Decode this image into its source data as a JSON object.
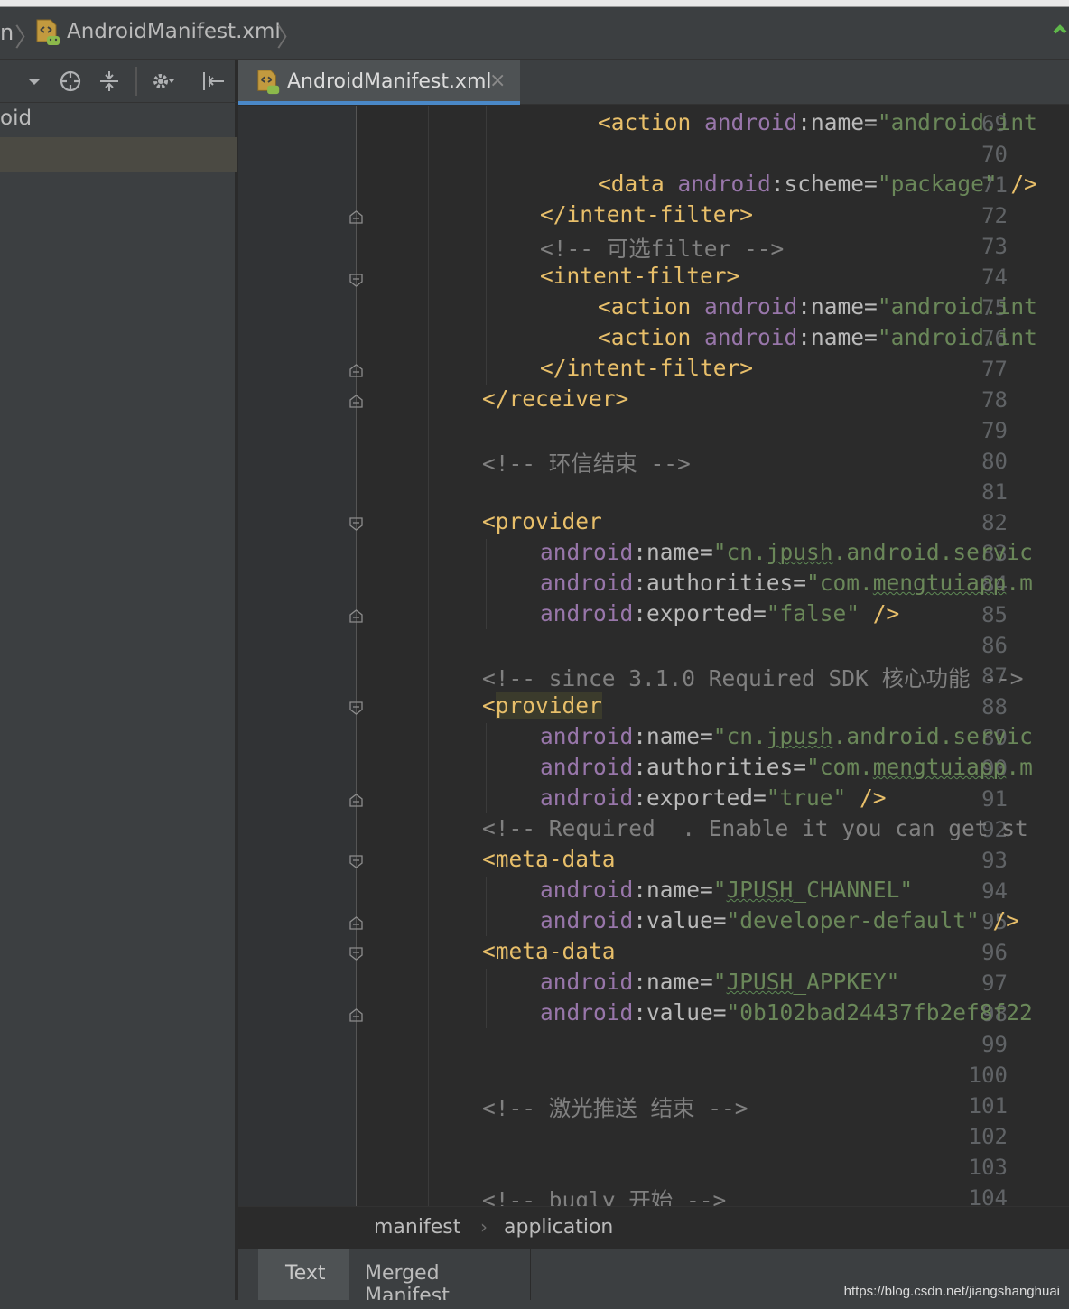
{
  "nav": {
    "crumb_start": "n",
    "file": "AndroidManifest.xml"
  },
  "project": {
    "tree_row": "oid"
  },
  "tab": {
    "label": "AndroidManifest.xml",
    "close": "×"
  },
  "line_numbers": [
    "69",
    "70",
    "71",
    "72",
    "73",
    "74",
    "75",
    "76",
    "77",
    "78",
    "79",
    "80",
    "81",
    "82",
    "83",
    "84",
    "85",
    "86",
    "87",
    "88",
    "89",
    "90",
    "91",
    "92",
    "93",
    "94",
    "95",
    "96",
    "97",
    "98",
    "99",
    "100",
    "101",
    "102",
    "103",
    "104"
  ],
  "code": {
    "l69": {
      "tag": "<action",
      "ns": "android",
      "attr": ":name=",
      "val": "\"android.int"
    },
    "l71": {
      "tag": "<data",
      "ns": "android",
      "attr": ":scheme=",
      "val": "\"package\"",
      "close": " />"
    },
    "l72": {
      "tag": "</intent-filter>"
    },
    "l73": {
      "cmt": "<!-- 可选filter -->"
    },
    "l74": {
      "tag": "<intent-filter>"
    },
    "l75": {
      "tag": "<action",
      "ns": "android",
      "attr": ":name=",
      "val": "\"android.int"
    },
    "l76": {
      "tag": "<action",
      "ns": "android",
      "attr": ":name=",
      "val": "\"android.int"
    },
    "l77": {
      "tag": "</intent-filter>"
    },
    "l78": {
      "tag": "</receiver>"
    },
    "l80": {
      "cmt": "<!-- 环信结束 -->"
    },
    "l82": {
      "tag": "<provider"
    },
    "l83": {
      "ns": "android",
      "attr": ":name=",
      "val_pre": "\"cn.",
      "val_sq": "jpush",
      "val_post": ".android.servic"
    },
    "l84": {
      "ns": "android",
      "attr": ":authorities=",
      "val_pre": "\"com.",
      "val_sq": "mengtuiapp",
      "val_post": ".m"
    },
    "l85": {
      "ns": "android",
      "attr": ":exported=",
      "val": "\"false\"",
      "close": " />"
    },
    "l87": {
      "cmt": "<!-- since 3.1.0 Required SDK 核心功能 -->"
    },
    "l88": {
      "tag_lt": "<",
      "tag_name": "provider"
    },
    "l89": {
      "ns": "android",
      "attr": ":name=",
      "val_pre": "\"cn.",
      "val_sq": "jpush",
      "val_post": ".android.servic"
    },
    "l90": {
      "ns": "android",
      "attr": ":authorities=",
      "val_pre": "\"com.",
      "val_sq": "mengtuiapp",
      "val_post": ".m"
    },
    "l91": {
      "ns": "android",
      "attr": ":exported=",
      "val": "\"true\"",
      "close": " />"
    },
    "l92": {
      "cmt": "<!-- Required  . Enable it you can get st"
    },
    "l93": {
      "tag": "<meta-data"
    },
    "l94": {
      "ns": "android",
      "attr": ":name=",
      "val_pre": "\"",
      "val_sq": "JPUSH",
      "val_post": "_CHANNEL\""
    },
    "l95": {
      "ns": "android",
      "attr": ":value=",
      "val": "\"developer-default\"",
      "close": " />"
    },
    "l96": {
      "tag": "<meta-data"
    },
    "l97": {
      "ns": "android",
      "attr": ":name=",
      "val_pre": "\"",
      "val_sq": "JPUSH",
      "val_post": "_APPKEY\""
    },
    "l98": {
      "ns": "android",
      "attr": ":value=",
      "val": "\"0b102bad24437fb2ef8f22"
    },
    "l101": {
      "cmt": "<!-- 激光推送 结束 -->"
    },
    "l104": {
      "cmt": "<!-- bugly 开始 -->"
    }
  },
  "xml_breadcrumb": {
    "item1": "manifest",
    "sep": "›",
    "item2": "application"
  },
  "bottom_tabs": {
    "text": "Text",
    "merged": "Merged Manifest"
  },
  "watermark": "https://blog.csdn.net/jiangshanghuai",
  "colors": {
    "tag": "#e8bf6a",
    "namespace": "#9876aa",
    "value": "#6a8759",
    "comment": "#808080",
    "background": "#2b2b2b"
  }
}
